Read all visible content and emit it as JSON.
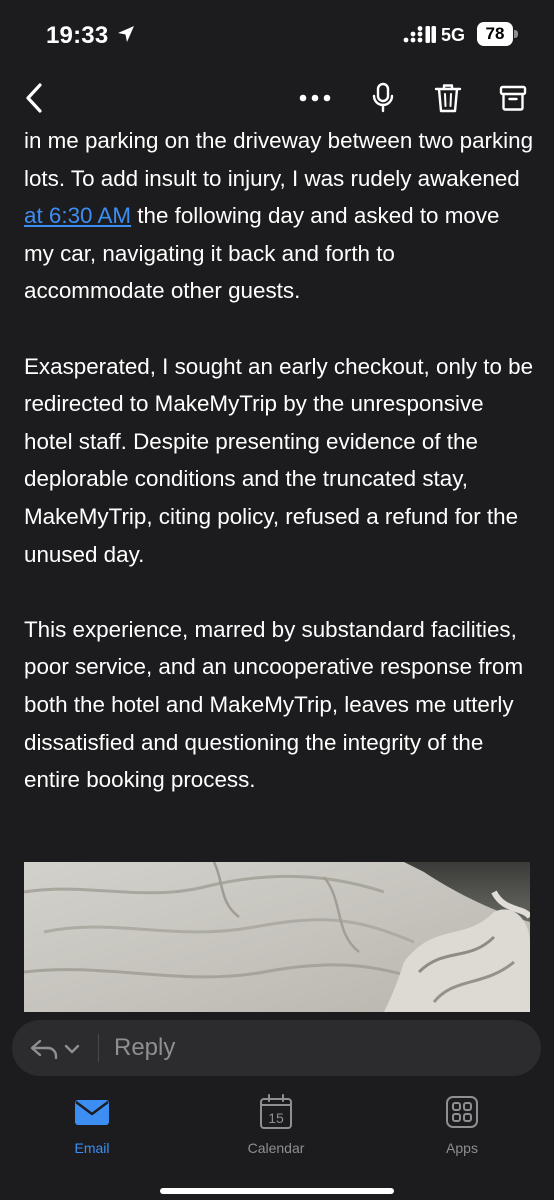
{
  "status_bar": {
    "time": "19:33",
    "network": "5G",
    "battery": "78"
  },
  "body": {
    "para1_before": "in me parking on the driveway between two parking lots. To add insult to injury, I was rudely awakened ",
    "para1_link": "at 6:30 AM",
    "para1_after": " the following day and asked to move my car, navigating it back and forth to accommodate other guests.",
    "para2": "Exasperated, I sought an early checkout, only to be redirected to MakeMyTrip by the unresponsive hotel staff. Despite presenting evidence of the deplorable conditions and the truncated stay, MakeMyTrip, citing policy, refused a refund for the unused day.",
    "para3": "This experience, marred by substandard facilities, poor service, and an uncooperative response from both the hotel and MakeMyTrip, leaves me utterly dissatisfied and questioning the integrity of the entire booking process."
  },
  "reply": {
    "label": "Reply"
  },
  "tabs": [
    {
      "label": "Email",
      "icon": "envelope-icon",
      "active": true
    },
    {
      "label": "Calendar",
      "icon": "calendar-icon",
      "day": "15",
      "active": false
    },
    {
      "label": "Apps",
      "icon": "apps-grid-icon",
      "active": false
    }
  ],
  "colors": {
    "background": "#1c1c1e",
    "accent": "#3d8ef2",
    "muted": "#8e8e93",
    "reply_field": "#2c2c2e"
  }
}
